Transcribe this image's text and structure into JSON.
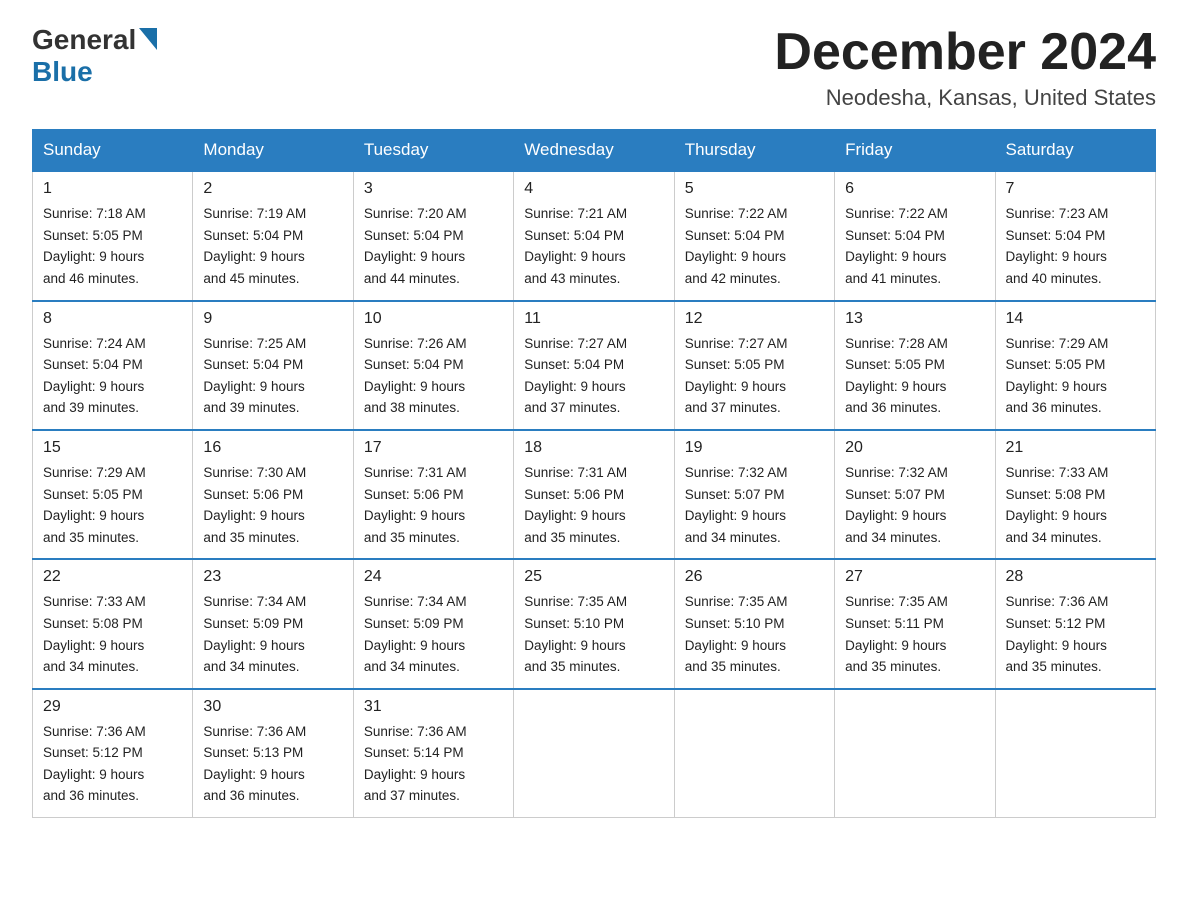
{
  "header": {
    "logo_general": "General",
    "logo_blue": "Blue",
    "month_title": "December 2024",
    "location": "Neodesha, Kansas, United States"
  },
  "calendar": {
    "days_of_week": [
      "Sunday",
      "Monday",
      "Tuesday",
      "Wednesday",
      "Thursday",
      "Friday",
      "Saturday"
    ],
    "weeks": [
      [
        {
          "day": "1",
          "sunrise": "7:18 AM",
          "sunset": "5:05 PM",
          "daylight": "9 hours and 46 minutes."
        },
        {
          "day": "2",
          "sunrise": "7:19 AM",
          "sunset": "5:04 PM",
          "daylight": "9 hours and 45 minutes."
        },
        {
          "day": "3",
          "sunrise": "7:20 AM",
          "sunset": "5:04 PM",
          "daylight": "9 hours and 44 minutes."
        },
        {
          "day": "4",
          "sunrise": "7:21 AM",
          "sunset": "5:04 PM",
          "daylight": "9 hours and 43 minutes."
        },
        {
          "day": "5",
          "sunrise": "7:22 AM",
          "sunset": "5:04 PM",
          "daylight": "9 hours and 42 minutes."
        },
        {
          "day": "6",
          "sunrise": "7:22 AM",
          "sunset": "5:04 PM",
          "daylight": "9 hours and 41 minutes."
        },
        {
          "day": "7",
          "sunrise": "7:23 AM",
          "sunset": "5:04 PM",
          "daylight": "9 hours and 40 minutes."
        }
      ],
      [
        {
          "day": "8",
          "sunrise": "7:24 AM",
          "sunset": "5:04 PM",
          "daylight": "9 hours and 39 minutes."
        },
        {
          "day": "9",
          "sunrise": "7:25 AM",
          "sunset": "5:04 PM",
          "daylight": "9 hours and 39 minutes."
        },
        {
          "day": "10",
          "sunrise": "7:26 AM",
          "sunset": "5:04 PM",
          "daylight": "9 hours and 38 minutes."
        },
        {
          "day": "11",
          "sunrise": "7:27 AM",
          "sunset": "5:04 PM",
          "daylight": "9 hours and 37 minutes."
        },
        {
          "day": "12",
          "sunrise": "7:27 AM",
          "sunset": "5:05 PM",
          "daylight": "9 hours and 37 minutes."
        },
        {
          "day": "13",
          "sunrise": "7:28 AM",
          "sunset": "5:05 PM",
          "daylight": "9 hours and 36 minutes."
        },
        {
          "day": "14",
          "sunrise": "7:29 AM",
          "sunset": "5:05 PM",
          "daylight": "9 hours and 36 minutes."
        }
      ],
      [
        {
          "day": "15",
          "sunrise": "7:29 AM",
          "sunset": "5:05 PM",
          "daylight": "9 hours and 35 minutes."
        },
        {
          "day": "16",
          "sunrise": "7:30 AM",
          "sunset": "5:06 PM",
          "daylight": "9 hours and 35 minutes."
        },
        {
          "day": "17",
          "sunrise": "7:31 AM",
          "sunset": "5:06 PM",
          "daylight": "9 hours and 35 minutes."
        },
        {
          "day": "18",
          "sunrise": "7:31 AM",
          "sunset": "5:06 PM",
          "daylight": "9 hours and 35 minutes."
        },
        {
          "day": "19",
          "sunrise": "7:32 AM",
          "sunset": "5:07 PM",
          "daylight": "9 hours and 34 minutes."
        },
        {
          "day": "20",
          "sunrise": "7:32 AM",
          "sunset": "5:07 PM",
          "daylight": "9 hours and 34 minutes."
        },
        {
          "day": "21",
          "sunrise": "7:33 AM",
          "sunset": "5:08 PM",
          "daylight": "9 hours and 34 minutes."
        }
      ],
      [
        {
          "day": "22",
          "sunrise": "7:33 AM",
          "sunset": "5:08 PM",
          "daylight": "9 hours and 34 minutes."
        },
        {
          "day": "23",
          "sunrise": "7:34 AM",
          "sunset": "5:09 PM",
          "daylight": "9 hours and 34 minutes."
        },
        {
          "day": "24",
          "sunrise": "7:34 AM",
          "sunset": "5:09 PM",
          "daylight": "9 hours and 34 minutes."
        },
        {
          "day": "25",
          "sunrise": "7:35 AM",
          "sunset": "5:10 PM",
          "daylight": "9 hours and 35 minutes."
        },
        {
          "day": "26",
          "sunrise": "7:35 AM",
          "sunset": "5:10 PM",
          "daylight": "9 hours and 35 minutes."
        },
        {
          "day": "27",
          "sunrise": "7:35 AM",
          "sunset": "5:11 PM",
          "daylight": "9 hours and 35 minutes."
        },
        {
          "day": "28",
          "sunrise": "7:36 AM",
          "sunset": "5:12 PM",
          "daylight": "9 hours and 35 minutes."
        }
      ],
      [
        {
          "day": "29",
          "sunrise": "7:36 AM",
          "sunset": "5:12 PM",
          "daylight": "9 hours and 36 minutes."
        },
        {
          "day": "30",
          "sunrise": "7:36 AM",
          "sunset": "5:13 PM",
          "daylight": "9 hours and 36 minutes."
        },
        {
          "day": "31",
          "sunrise": "7:36 AM",
          "sunset": "5:14 PM",
          "daylight": "9 hours and 37 minutes."
        },
        null,
        null,
        null,
        null
      ]
    ],
    "sunrise_label": "Sunrise:",
    "sunset_label": "Sunset:",
    "daylight_label": "Daylight:"
  }
}
